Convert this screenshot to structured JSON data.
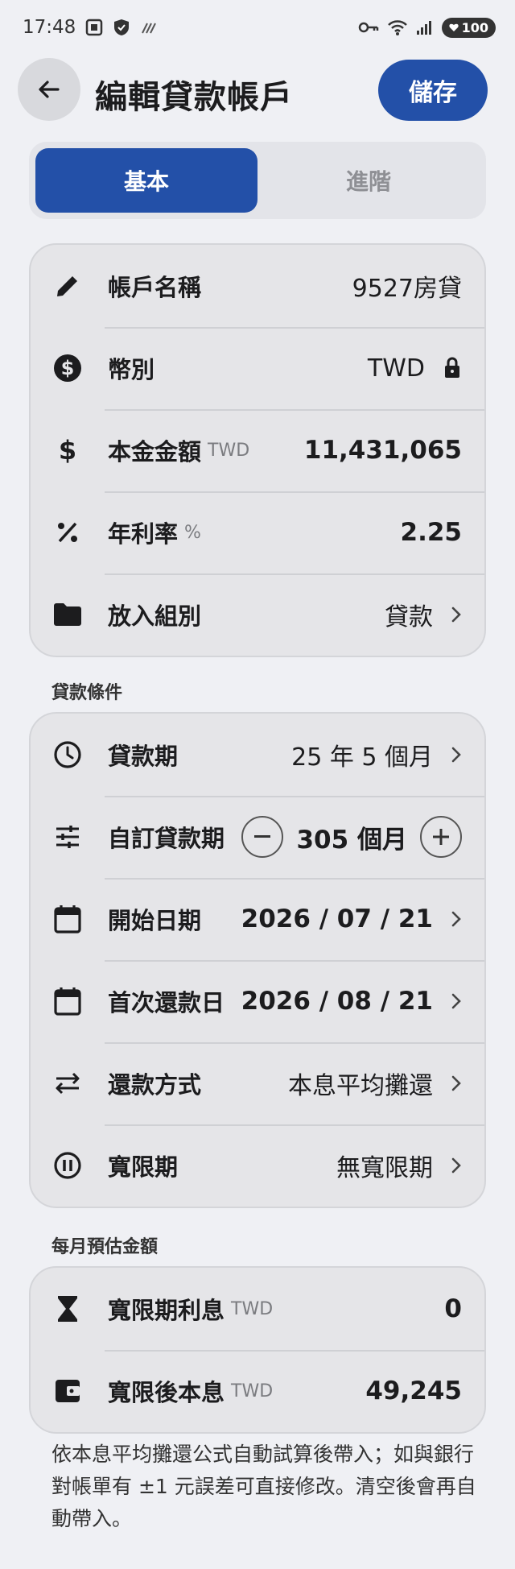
{
  "status_bar": {
    "time": "17:48",
    "battery": "100",
    "icons": [
      "screenshot-icon",
      "shield-icon",
      "no-signal-icon",
      "key-icon",
      "wifi-icon",
      "cell-signal-icon"
    ]
  },
  "header": {
    "title": "編輯貸款帳戶",
    "save_label": "儲存"
  },
  "tabs": [
    {
      "label": "基本",
      "active": true
    },
    {
      "label": "進階",
      "active": false
    }
  ],
  "basic": {
    "account_name_label": "帳戶名稱",
    "account_name_value": "9527房貸",
    "currency_label": "幣別",
    "currency_value": "TWD",
    "principal_label": "本金金額",
    "principal_unit": "TWD",
    "principal_value": "11,431,065",
    "rate_label": "年利率",
    "rate_unit": "%",
    "rate_value": "2.25",
    "group_label": "放入組別",
    "group_value": "貸款"
  },
  "loan_terms": {
    "section_title": "貸款條件",
    "term_label": "貸款期",
    "term_value": "25 年 5 個月",
    "custom_term_label": "自訂貸款期",
    "custom_term_value": "305 個月",
    "start_date_label": "開始日期",
    "start_date_value": "2026 / 07 / 21",
    "first_payment_label": "首次還款日",
    "first_payment_value": "2026 / 08 / 21",
    "method_label": "還款方式",
    "method_value": "本息平均攤還",
    "grace_label": "寬限期",
    "grace_value": "無寬限期"
  },
  "monthly": {
    "section_title": "每月預估金額",
    "grace_interest_label": "寬限期利息",
    "grace_interest_unit": "TWD",
    "grace_interest_value": "0",
    "after_grace_label": "寬限後本息",
    "after_grace_unit": "TWD",
    "after_grace_value": "49,245"
  },
  "note": "依本息平均攤還公式自動試算後帶入；如與銀行對帳單有 ±1 元誤差可直接修改。清空後會再自動帶入。",
  "colors": {
    "accent": "#2350a8",
    "background": "#eff0f4",
    "card": "#e5e5e8"
  }
}
